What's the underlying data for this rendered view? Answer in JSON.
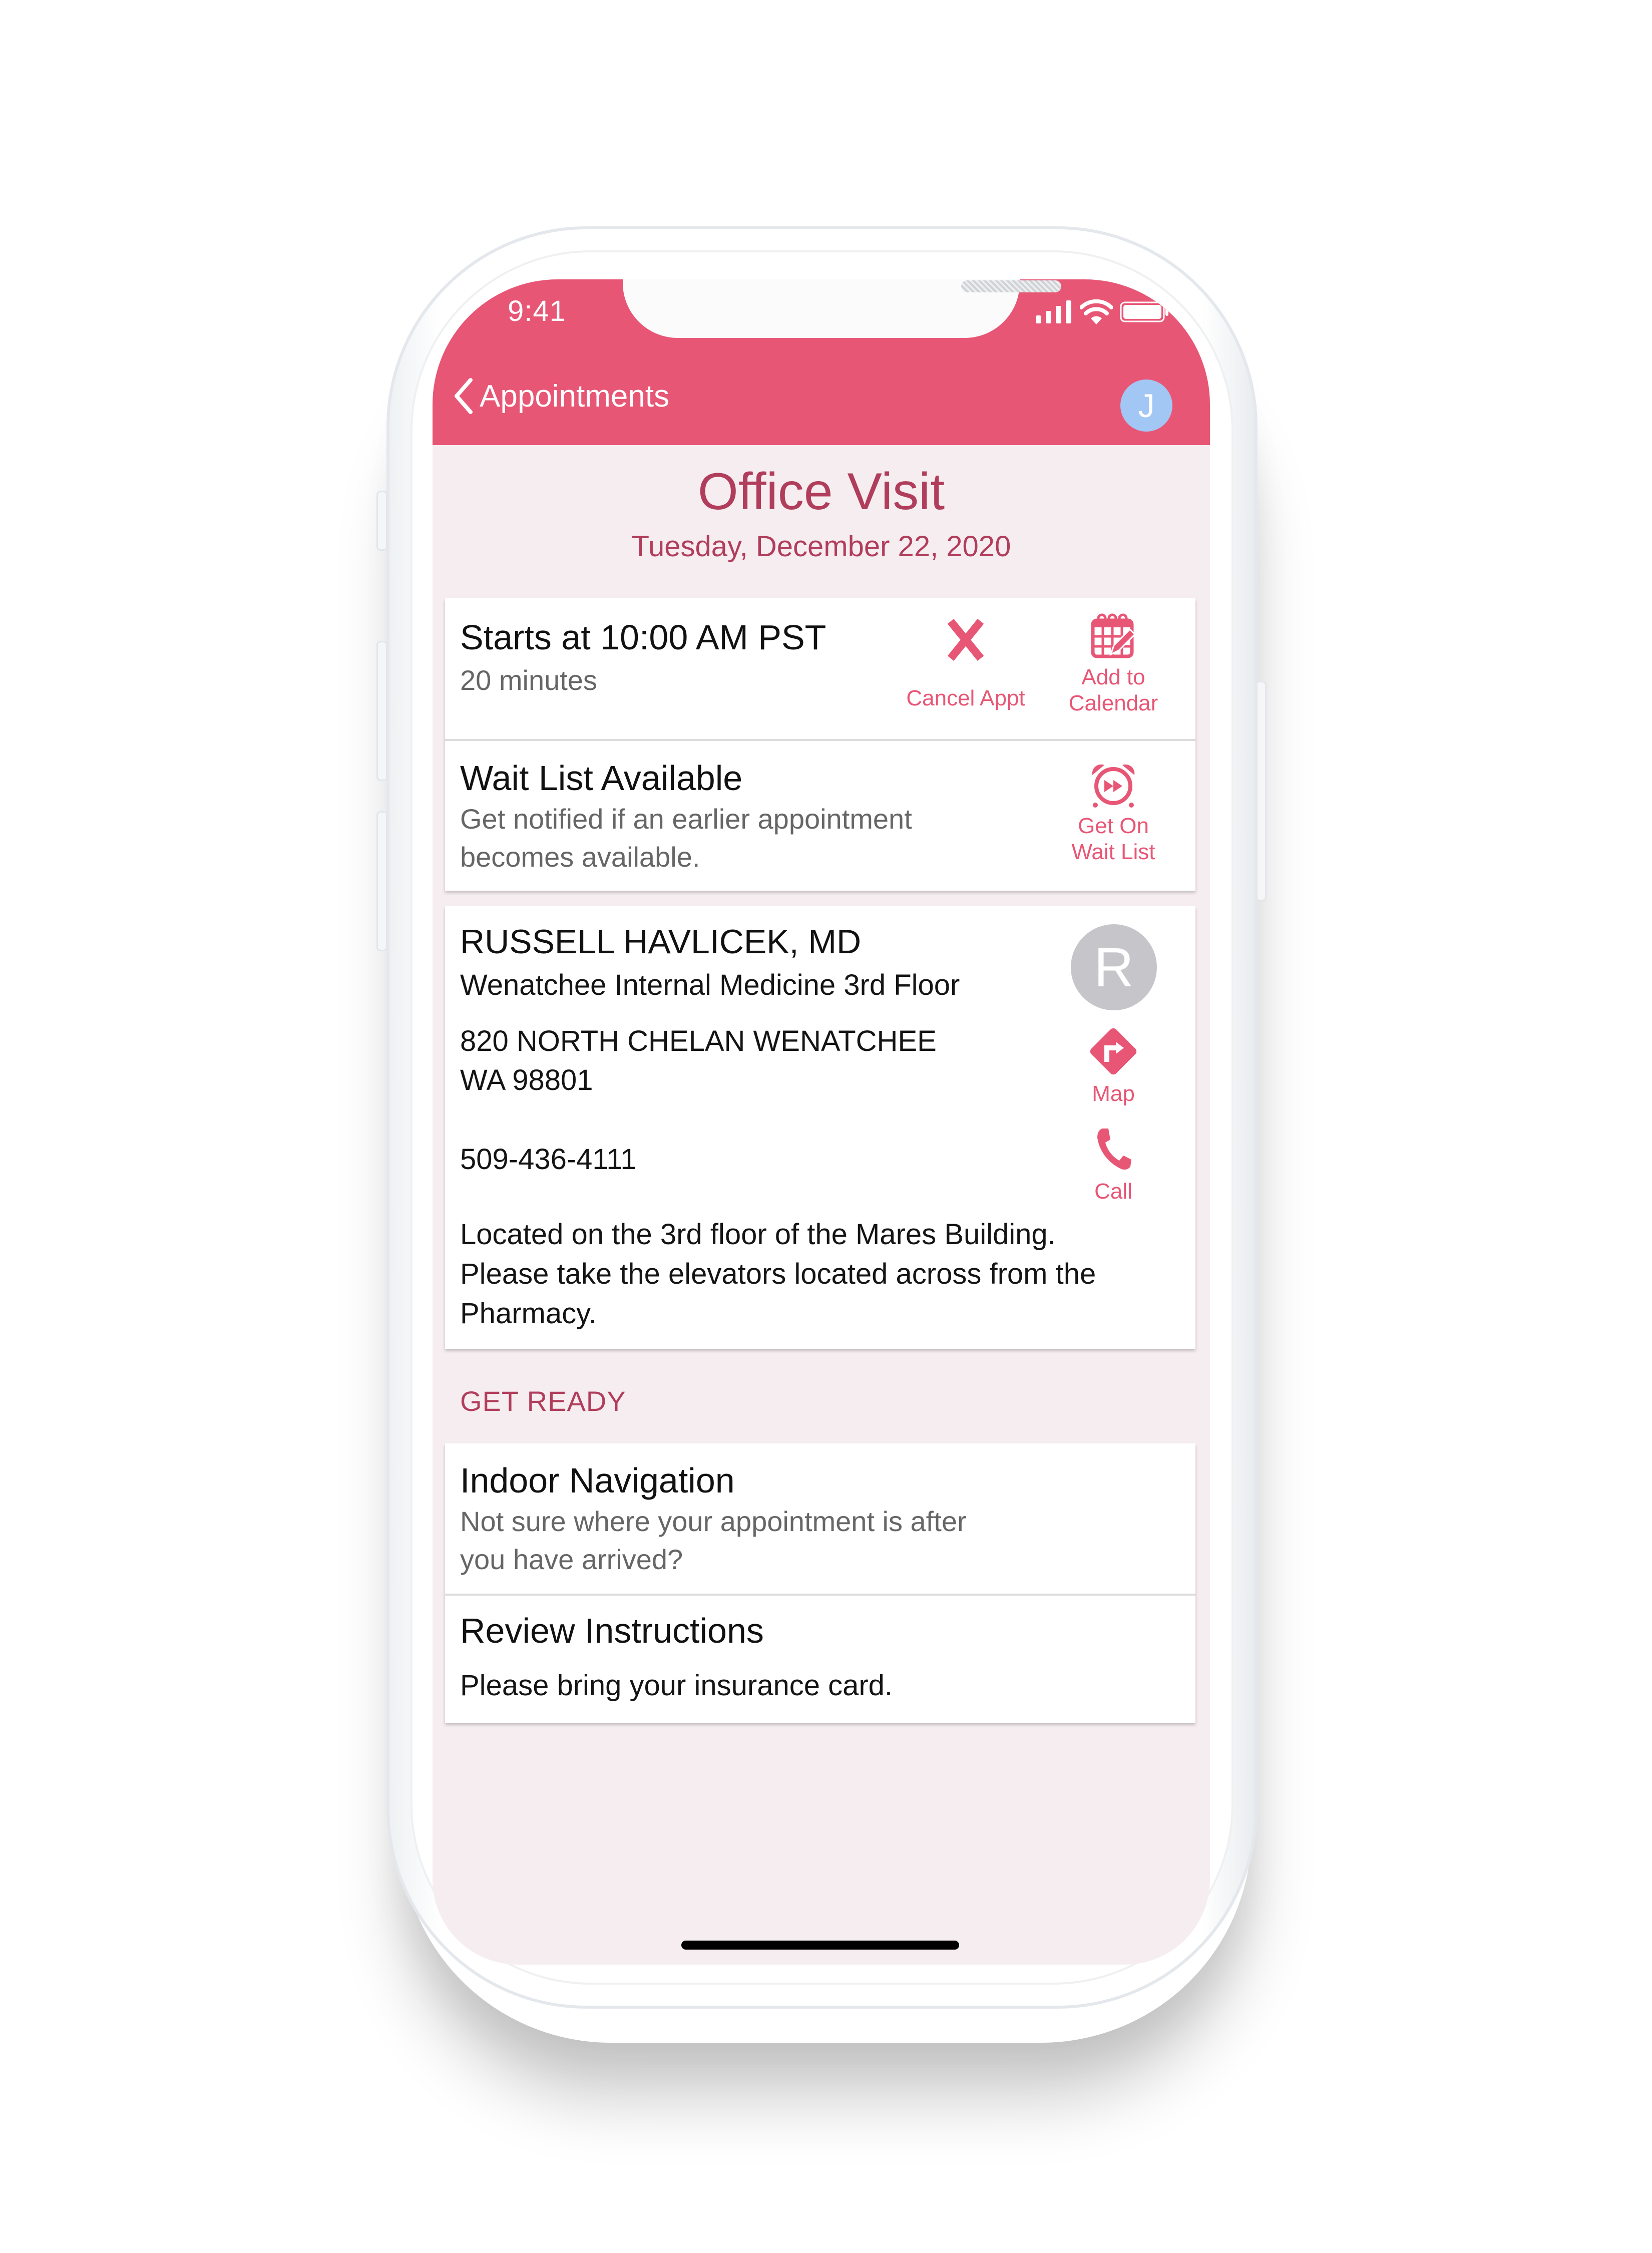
{
  "status_bar": {
    "time": "9:41",
    "icons": [
      "signal-icon",
      "wifi-icon",
      "battery-icon"
    ]
  },
  "nav": {
    "back_label": "Appointments",
    "avatar_initial": "J"
  },
  "appointment": {
    "type": "Office Visit",
    "date": "Tuesday, December 22, 2020",
    "start": "Starts at 10:00 AM PST",
    "duration": "20 minutes",
    "actions": {
      "cancel": "Cancel Appt",
      "calendar_line1": "Add to",
      "calendar_line2": "Calendar"
    }
  },
  "wait_list": {
    "title": "Wait List Available",
    "desc_line1": "Get notified if an earlier appointment",
    "desc_line2": "becomes available.",
    "action_line1": "Get On",
    "action_line2": "Wait List"
  },
  "provider": {
    "name": "RUSSELL HAVLICEK, MD",
    "department": "Wenatchee Internal Medicine 3rd Floor",
    "address_line1": "820 NORTH CHELAN WENATCHEE",
    "address_line2": "WA 98801",
    "phone": "509-436-4111",
    "avatar_initial": "R",
    "map_label": "Map",
    "call_label": "Call",
    "directions_line1": "Located on the 3rd floor of the Mares Building.",
    "directions_line2": "Please take the elevators  located across from the",
    "directions_line3": "Pharmacy."
  },
  "get_ready": {
    "section_label": "GET READY",
    "items": [
      {
        "title": "Indoor Navigation",
        "desc_line1": "Not sure where your appointment is after",
        "desc_line2": "you have arrived?"
      },
      {
        "title": "Review Instructions",
        "desc_line1": "Please bring your insurance card."
      }
    ]
  },
  "colors": {
    "accent": "#e85675",
    "title": "#b13d5c",
    "background": "#f6edf0",
    "avatar_user": "#a3c7f5",
    "avatar_provider": "#c6c6ca"
  }
}
